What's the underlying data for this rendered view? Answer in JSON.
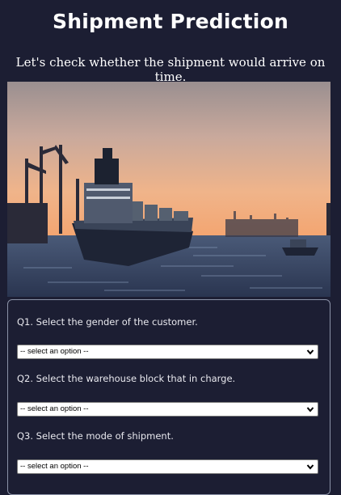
{
  "header": {
    "title": "Shipment Prediction",
    "subtitle": "Let's check whether the shipment would arrive on time."
  },
  "hero": {
    "image": "cargo-ship-at-port-sunset"
  },
  "form": {
    "questions": [
      {
        "label": "Q1. Select the gender of the customer.",
        "placeholder": "-- select an option --"
      },
      {
        "label": "Q2. Select the warehouse block that in charge.",
        "placeholder": "-- select an option --"
      },
      {
        "label": "Q3. Select the mode of shipment.",
        "placeholder": "-- select an option --"
      }
    ]
  },
  "icons": {
    "dropdown": "chevron-down-icon"
  }
}
